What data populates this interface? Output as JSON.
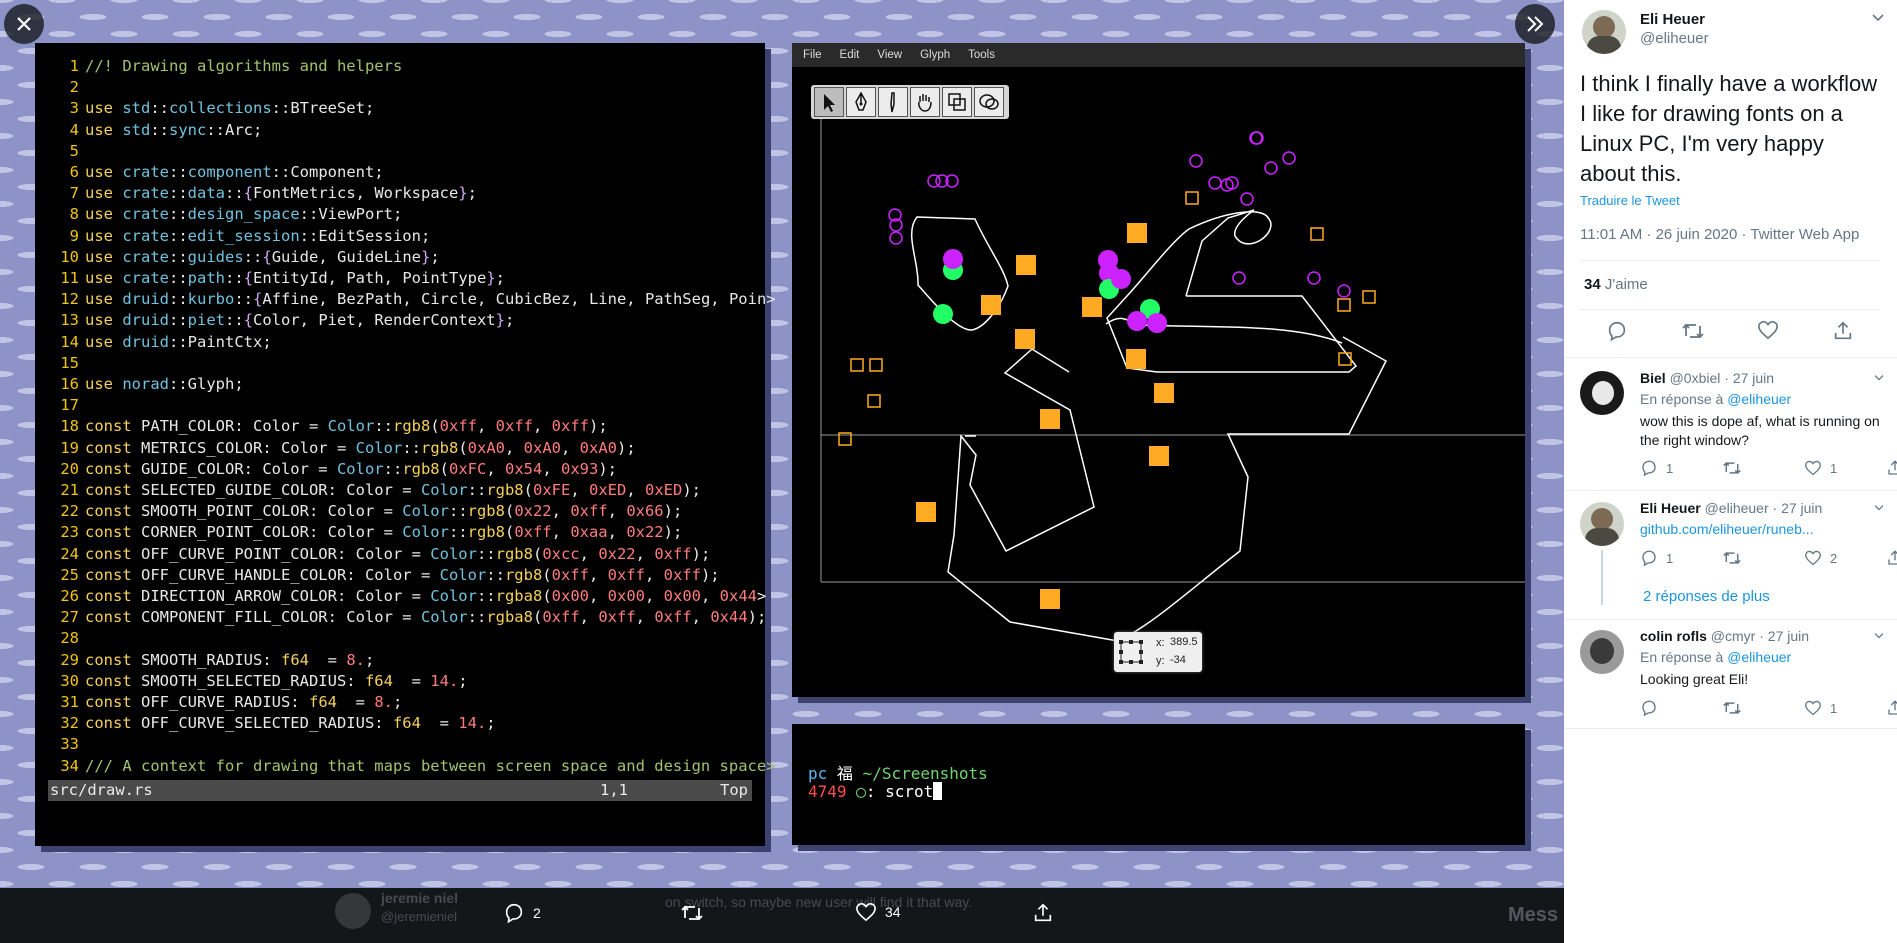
{
  "viewer": {
    "editor": {
      "lines": [
        [
          [
            "cm",
            "//! Drawing algorithms and helpers"
          ]
        ],
        [],
        [
          [
            "kw",
            "use "
          ],
          [
            "tp",
            "std"
          ],
          [
            "",
            "::"
          ],
          [
            "tp",
            "collections"
          ],
          [
            "",
            "::BTreeSet;"
          ]
        ],
        [
          [
            "kw",
            "use "
          ],
          [
            "tp",
            "std"
          ],
          [
            "",
            "::"
          ],
          [
            "tp",
            "sync"
          ],
          [
            "",
            "::Arc;"
          ]
        ],
        [],
        [
          [
            "kw",
            "use "
          ],
          [
            "tp",
            "crate"
          ],
          [
            "",
            "::"
          ],
          [
            "tp",
            "component"
          ],
          [
            "",
            "::Component;"
          ]
        ],
        [
          [
            "kw",
            "use "
          ],
          [
            "tp",
            "crate"
          ],
          [
            "",
            "::"
          ],
          [
            "tp",
            "data"
          ],
          [
            "",
            "::"
          ],
          [
            "str",
            "{"
          ],
          [
            "",
            "FontMetrics, Workspace"
          ],
          [
            "str",
            "}"
          ],
          [
            "",
            ";"
          ]
        ],
        [
          [
            "kw",
            "use "
          ],
          [
            "tp",
            "crate"
          ],
          [
            "",
            "::"
          ],
          [
            "tp",
            "design_space"
          ],
          [
            "",
            "::ViewPort;"
          ]
        ],
        [
          [
            "kw",
            "use "
          ],
          [
            "tp",
            "crate"
          ],
          [
            "",
            "::"
          ],
          [
            "tp",
            "edit_session"
          ],
          [
            "",
            "::EditSession;"
          ]
        ],
        [
          [
            "kw",
            "use "
          ],
          [
            "tp",
            "crate"
          ],
          [
            "",
            "::"
          ],
          [
            "tp",
            "guides"
          ],
          [
            "",
            "::"
          ],
          [
            "str",
            "{"
          ],
          [
            "",
            "Guide, GuideLine"
          ],
          [
            "str",
            "}"
          ],
          [
            "",
            ";"
          ]
        ],
        [
          [
            "kw",
            "use "
          ],
          [
            "tp",
            "crate"
          ],
          [
            "",
            "::"
          ],
          [
            "tp",
            "path"
          ],
          [
            "",
            "::"
          ],
          [
            "str",
            "{"
          ],
          [
            "",
            "EntityId, Path, PointType"
          ],
          [
            "str",
            "}"
          ],
          [
            "",
            ";"
          ]
        ],
        [
          [
            "kw",
            "use "
          ],
          [
            "tp",
            "druid"
          ],
          [
            "",
            "::"
          ],
          [
            "tp",
            "kurbo"
          ],
          [
            "",
            "::"
          ],
          [
            "str",
            "{"
          ],
          [
            "",
            "Affine, BezPath, Circle, CubicBez, Line, PathSeg, Poin>"
          ]
        ],
        [
          [
            "kw",
            "use "
          ],
          [
            "tp",
            "druid"
          ],
          [
            "",
            "::"
          ],
          [
            "tp",
            "piet"
          ],
          [
            "",
            "::"
          ],
          [
            "str",
            "{"
          ],
          [
            "",
            "Color, Piet, RenderContext"
          ],
          [
            "str",
            "}"
          ],
          [
            "",
            ";"
          ]
        ],
        [
          [
            "kw",
            "use "
          ],
          [
            "tp",
            "druid"
          ],
          [
            "",
            "::PaintCtx;"
          ]
        ],
        [],
        [
          [
            "kw",
            "use "
          ],
          [
            "tp",
            "norad"
          ],
          [
            "",
            "::Glyph;"
          ]
        ],
        [],
        [
          [
            "kw",
            "const "
          ],
          [
            "",
            "PATH_COLOR: Color = "
          ],
          [
            "tp",
            "Color"
          ],
          [
            "",
            "::"
          ],
          [
            "kw",
            "rgb8"
          ],
          [
            "",
            "("
          ],
          [
            "num",
            "0xff"
          ],
          [
            "",
            ", "
          ],
          [
            "num",
            "0xff"
          ],
          [
            "",
            ", "
          ],
          [
            "num",
            "0xff"
          ],
          [
            "",
            ");"
          ]
        ],
        [
          [
            "kw",
            "const "
          ],
          [
            "",
            "METRICS_COLOR: Color = "
          ],
          [
            "tp",
            "Color"
          ],
          [
            "",
            "::"
          ],
          [
            "kw",
            "rgb8"
          ],
          [
            "",
            "("
          ],
          [
            "num",
            "0xA0"
          ],
          [
            "",
            ", "
          ],
          [
            "num",
            "0xA0"
          ],
          [
            "",
            ", "
          ],
          [
            "num",
            "0xA0"
          ],
          [
            "",
            ");"
          ]
        ],
        [
          [
            "kw",
            "const "
          ],
          [
            "",
            "GUIDE_COLOR: Color = "
          ],
          [
            "tp",
            "Color"
          ],
          [
            "",
            "::"
          ],
          [
            "kw",
            "rgb8"
          ],
          [
            "",
            "("
          ],
          [
            "num",
            "0xFC"
          ],
          [
            "",
            ", "
          ],
          [
            "num",
            "0x54"
          ],
          [
            "",
            ", "
          ],
          [
            "num",
            "0x93"
          ],
          [
            "",
            ");"
          ]
        ],
        [
          [
            "kw",
            "const "
          ],
          [
            "",
            "SELECTED_GUIDE_COLOR: Color = "
          ],
          [
            "tp",
            "Color"
          ],
          [
            "",
            "::"
          ],
          [
            "kw",
            "rgb8"
          ],
          [
            "",
            "("
          ],
          [
            "num",
            "0xFE"
          ],
          [
            "",
            ", "
          ],
          [
            "num",
            "0xED"
          ],
          [
            "",
            ", "
          ],
          [
            "num",
            "0xED"
          ],
          [
            "",
            ");"
          ]
        ],
        [
          [
            "kw",
            "const "
          ],
          [
            "",
            "SMOOTH_POINT_COLOR: Color = "
          ],
          [
            "tp",
            "Color"
          ],
          [
            "",
            "::"
          ],
          [
            "kw",
            "rgb8"
          ],
          [
            "",
            "("
          ],
          [
            "num",
            "0x22"
          ],
          [
            "",
            ", "
          ],
          [
            "num",
            "0xff"
          ],
          [
            "",
            ", "
          ],
          [
            "num",
            "0x66"
          ],
          [
            "",
            ");"
          ]
        ],
        [
          [
            "kw",
            "const "
          ],
          [
            "",
            "CORNER_POINT_COLOR: Color = "
          ],
          [
            "tp",
            "Color"
          ],
          [
            "",
            "::"
          ],
          [
            "kw",
            "rgb8"
          ],
          [
            "",
            "("
          ],
          [
            "num",
            "0xff"
          ],
          [
            "",
            ", "
          ],
          [
            "num",
            "0xaa"
          ],
          [
            "",
            ", "
          ],
          [
            "num",
            "0x22"
          ],
          [
            "",
            ");"
          ]
        ],
        [
          [
            "kw",
            "const "
          ],
          [
            "",
            "OFF_CURVE_POINT_COLOR: Color = "
          ],
          [
            "tp",
            "Color"
          ],
          [
            "",
            "::"
          ],
          [
            "kw",
            "rgb8"
          ],
          [
            "",
            "("
          ],
          [
            "num",
            "0xcc"
          ],
          [
            "",
            ", "
          ],
          [
            "num",
            "0x22"
          ],
          [
            "",
            ", "
          ],
          [
            "num",
            "0xff"
          ],
          [
            "",
            ");"
          ]
        ],
        [
          [
            "kw",
            "const "
          ],
          [
            "",
            "OFF_CURVE_HANDLE_COLOR: Color = "
          ],
          [
            "tp",
            "Color"
          ],
          [
            "",
            "::"
          ],
          [
            "kw",
            "rgb8"
          ],
          [
            "",
            "("
          ],
          [
            "num",
            "0xff"
          ],
          [
            "",
            ", "
          ],
          [
            "num",
            "0xff"
          ],
          [
            "",
            ", "
          ],
          [
            "num",
            "0xff"
          ],
          [
            "",
            ");"
          ]
        ],
        [
          [
            "kw",
            "const "
          ],
          [
            "",
            "DIRECTION_ARROW_COLOR: Color = "
          ],
          [
            "tp",
            "Color"
          ],
          [
            "",
            "::"
          ],
          [
            "kw",
            "rgba8"
          ],
          [
            "",
            "("
          ],
          [
            "num",
            "0x00"
          ],
          [
            "",
            ", "
          ],
          [
            "num",
            "0x00"
          ],
          [
            "",
            ", "
          ],
          [
            "num",
            "0x00"
          ],
          [
            "",
            ", "
          ],
          [
            "num",
            "0x44"
          ],
          [
            "",
            ">"
          ]
        ],
        [
          [
            "kw",
            "const "
          ],
          [
            "",
            "COMPONENT_FILL_COLOR: Color = "
          ],
          [
            "tp",
            "Color"
          ],
          [
            "",
            "::"
          ],
          [
            "kw",
            "rgba8"
          ],
          [
            "",
            "("
          ],
          [
            "num",
            "0xff"
          ],
          [
            "",
            ", "
          ],
          [
            "num",
            "0xff"
          ],
          [
            "",
            ", "
          ],
          [
            "num",
            "0xff"
          ],
          [
            "",
            ", "
          ],
          [
            "num",
            "0x44"
          ],
          [
            "",
            ");"
          ]
        ],
        [],
        [
          [
            "kw",
            "const "
          ],
          [
            "",
            "SMOOTH_RADIUS: "
          ],
          [
            "kw",
            "f64"
          ],
          [
            "",
            ""
          ],
          [
            "",
            ""
          ],
          [
            "",
            "  = "
          ],
          [
            "num",
            "8."
          ],
          [
            "",
            ";"
          ]
        ],
        [
          [
            "kw",
            "const "
          ],
          [
            "",
            "SMOOTH_SELECTED_RADIUS: "
          ],
          [
            "kw",
            "f64"
          ],
          [
            "",
            "  = "
          ],
          [
            "num",
            "14."
          ],
          [
            "",
            ";"
          ]
        ],
        [
          [
            "kw",
            "const "
          ],
          [
            "",
            "OFF_CURVE_RADIUS: "
          ],
          [
            "kw",
            "f64"
          ],
          [
            "",
            "  = "
          ],
          [
            "num",
            "8."
          ],
          [
            "",
            ";"
          ]
        ],
        [
          [
            "kw",
            "const "
          ],
          [
            "",
            "OFF_CURVE_SELECTED_RADIUS: "
          ],
          [
            "kw",
            "f64"
          ],
          [
            "",
            "  = "
          ],
          [
            "num",
            "14."
          ],
          [
            "",
            ";"
          ]
        ],
        [],
        [
          [
            "cm",
            "/// A context for drawing that maps between screen space and design space>"
          ]
        ]
      ],
      "status": {
        "file": "src/draw.rs",
        "pos": "1,1",
        "top": "Top"
      }
    },
    "glyph_window": {
      "menu": [
        "File",
        "Edit",
        "View",
        "Glyph",
        "Tools"
      ],
      "tools": [
        "pointer-tool-icon",
        "pen-tool-icon",
        "knife-tool-icon",
        "hand-tool-icon",
        "rectangle-tool-icon",
        "ellipse-tool-icon"
      ],
      "coords": {
        "x_label": "x:",
        "x": "389.5",
        "y_label": "y:",
        "y": "-34"
      }
    },
    "terminal": {
      "host": "pc",
      "glyph": "福",
      "path": "~/Screenshots",
      "count": "4749",
      "circle": "◯",
      "colon": ":",
      "command": "scrot"
    },
    "footer": {
      "replies": "2",
      "likes": "34",
      "blur_name": "jeremie niel",
      "blur_handle": "@jeremieniel",
      "blur_text": "on switch, so maybe new user will find it that way.",
      "blur_mess": "Mess"
    },
    "colors": {
      "code_bg": "#000000",
      "keyword": "#f6d05a",
      "type": "#6fc3df",
      "number": "#ff7c7c",
      "corner": "#ffaa22",
      "smooth": "#22ff66",
      "offcurve": "#cc22ff"
    }
  },
  "sidebar": {
    "tweet": {
      "name": "Eli Heuer",
      "handle": "@eliheuer",
      "text": "I think I finally have a workflow I like for drawing fonts on a Linux PC, I'm very happy about this.",
      "translate": "Traduire le Tweet",
      "meta": "11:01 AM · 26 juin 2020 · Twitter Web App",
      "likes_count": "34",
      "likes_label": "J'aime"
    },
    "replies": [
      {
        "name": "Biel",
        "handle": "@0xbiel",
        "date": "· 27 juin",
        "reply_to_prefix": "En réponse à",
        "reply_to": "@eliheuer",
        "text": "wow this is dope af, what is running on the right window?",
        "reply_count": "1",
        "rt_count": "",
        "like_count": "1"
      },
      {
        "name": "Eli Heuer",
        "handle": "@eliheuer",
        "date": "· 27 juin",
        "link": "github.com/eliheuer/runeb...",
        "reply_count": "1",
        "rt_count": "",
        "like_count": "2"
      },
      {
        "name": "colin rofls",
        "handle": "@cmyr",
        "date": "· 27 juin",
        "reply_to_prefix": "En réponse à",
        "reply_to": "@eliheuer",
        "text": "Looking great Eli!",
        "reply_count": "",
        "rt_count": "",
        "like_count": "1"
      }
    ],
    "more_replies": "2 réponses de plus"
  }
}
